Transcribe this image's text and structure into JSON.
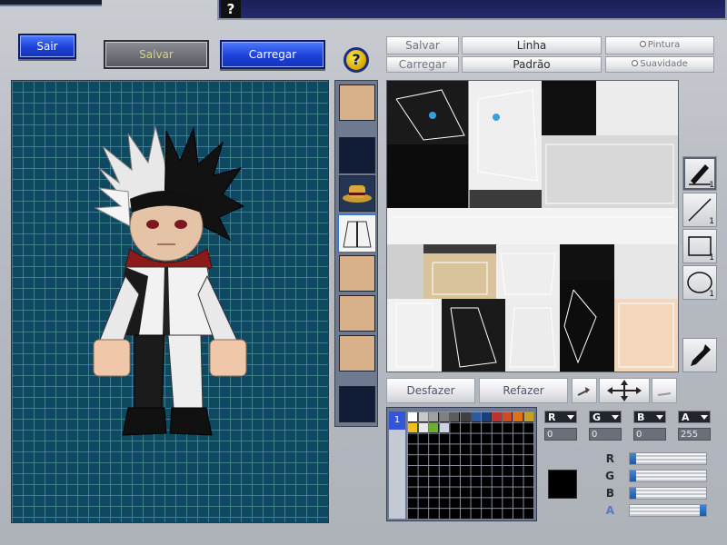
{
  "help_bar": {
    "icon": "question-icon",
    "label": "?"
  },
  "buttons": {
    "sair": "Sair",
    "salvar": "Salvar",
    "carregar": "Carregar",
    "help": "?"
  },
  "tool_tabs": {
    "salvar": "Salvar",
    "carregar": "Carregar",
    "linha": "Linha",
    "padrao": "Padrão",
    "pintura": "Pintura",
    "suavidade": "Suavidade"
  },
  "edit_buttons": {
    "desfazer": "Desfazer",
    "refazer": "Refazer"
  },
  "tools": [
    {
      "name": "pen-tool",
      "icon": "pen-icon",
      "size": "1"
    },
    {
      "name": "line-tool",
      "icon": "line-icon",
      "size": "1"
    },
    {
      "name": "rect-tool",
      "icon": "rectangle-icon",
      "size": "1"
    },
    {
      "name": "ellipse-tool",
      "icon": "ellipse-icon",
      "size": "1"
    }
  ],
  "palette": {
    "tab_number": "1",
    "top_row_colors": [
      "#ffffff",
      "#c8c8c8",
      "#a0a0a0",
      "#808080",
      "#5c5c5c",
      "#404040",
      "#2b5b9c",
      "#1c3f7a",
      "#c03030",
      "#d44a20",
      "#e07010",
      "#c8a020"
    ],
    "second_row_colors": [
      "#f0c020",
      "#e8e8e8",
      "#6ab030",
      "#d0d0e0"
    ],
    "current_color": "#000000"
  },
  "rgba": {
    "r_label": "R",
    "g_label": "G",
    "b_label": "B",
    "a_label": "A",
    "r": "0",
    "g": "0",
    "b": "0",
    "a": "255",
    "slider_r_label": "R",
    "slider_g_label": "G",
    "slider_b_label": "B",
    "slider_a_label": "A",
    "slider_r_fraction": 0,
    "slider_g_fraction": 0,
    "slider_b_fraction": 0,
    "slider_a_fraction": 1
  },
  "colors": {
    "accent_blue": "#1d40d8",
    "grid_bg": "#0f4960",
    "grid_line": "#1d8aa9"
  }
}
